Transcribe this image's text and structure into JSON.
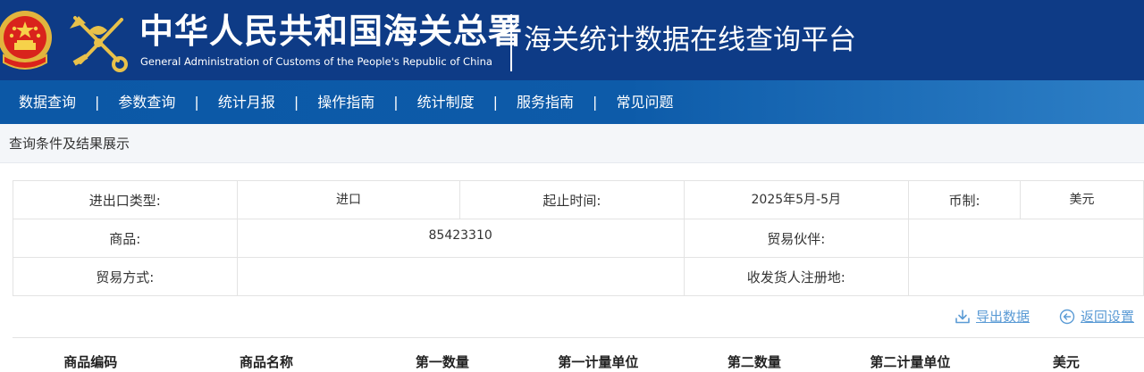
{
  "header": {
    "title_cn": "中华人民共和国海关总署",
    "title_en": "General Administration of Customs of the People's Republic of China",
    "platform_title": "海关统计数据在线查询平台",
    "emblem_icon": "national-emblem-icon",
    "customs_logo_icon": "customs-emblem-icon",
    "bg_color": "#0e3b86"
  },
  "nav": {
    "items": [
      "数据查询",
      "参数查询",
      "统计月报",
      "操作指南",
      "统计制度",
      "服务指南",
      "常见问题"
    ],
    "separator": "|",
    "bg_color": "#0c58a6"
  },
  "section": {
    "title": "查询条件及结果展示"
  },
  "criteria": {
    "trade_type_label": "进出口类型:",
    "trade_type_value": "进口",
    "period_label": "起止时间:",
    "period_value": "2025年5月-5月",
    "currency_label": "币制:",
    "currency_value": "美元",
    "commodity_label": "商品:",
    "commodity_value": "85423310",
    "partner_label": "贸易伙伴:",
    "partner_value": "",
    "trade_mode_label": "贸易方式:",
    "trade_mode_value": "",
    "registration_label": "收发货人注册地:",
    "registration_value": ""
  },
  "actions": {
    "export_label": "导出数据",
    "export_icon": "download-icon",
    "back_label": "返回设置",
    "back_icon": "back-arrow-icon",
    "link_color": "#5b9bd5"
  },
  "results": {
    "columns": [
      "商品编码",
      "商品名称",
      "第一数量",
      "第一计量单位",
      "第二数量",
      "第二计量单位",
      "美元"
    ]
  }
}
